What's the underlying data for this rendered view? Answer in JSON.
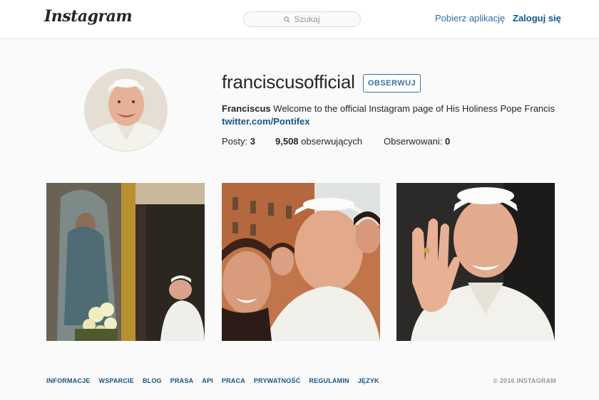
{
  "header": {
    "logo_text": "Instagram",
    "search_placeholder": "Szukaj",
    "search_icon": "search-icon",
    "get_app": "Pobierz aplikację",
    "login": "Zaloguj się"
  },
  "profile": {
    "username": "franciscusofficial",
    "follow_button": "OBSERWUJ",
    "full_name": "Franciscus",
    "bio": "Welcome to the official Instagram page of His Holiness Pope Francis",
    "link": "twitter.com/Pontifex",
    "stats": {
      "posts_label": "Posty:",
      "posts_value": "3",
      "followers_value": "9,508",
      "followers_label": "obserwujących",
      "following_label": "Obserwowani:",
      "following_value": "0"
    }
  },
  "posts": [
    {
      "subject": "praying-before-icon-photo"
    },
    {
      "subject": "selfie-photo"
    },
    {
      "subject": "waving-photo"
    }
  ],
  "footer": {
    "links": [
      "INFORMACJE",
      "WSPARCIE",
      "BLOG",
      "PRASA",
      "API",
      "PRACA",
      "PRYWATNOŚĆ",
      "REGULAMIN",
      "JĘZYK"
    ],
    "copyright": "© 2016 INSTAGRAM"
  },
  "colors": {
    "link": "#125688",
    "follow_border": "#3f729b",
    "background": "#fafafa"
  }
}
